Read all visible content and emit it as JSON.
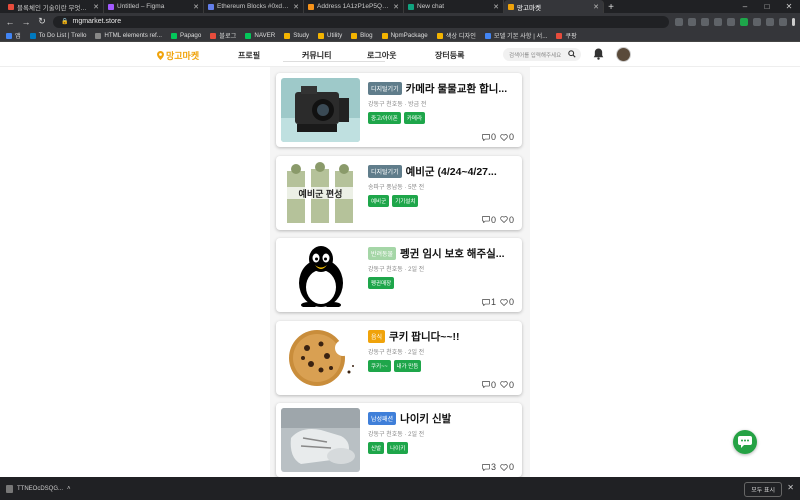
{
  "browser": {
    "tabs": [
      {
        "label": "블록체인 기술이란 무엇일까요?",
        "color": "#e74c3c"
      },
      {
        "label": "Untitled – Figma",
        "color": "#a259ff"
      },
      {
        "label": "Ethereum Blocks #0xdAe0674076",
        "color": "#627eea"
      },
      {
        "label": "Address 1A1zP1eP5QGefi2DMP",
        "color": "#f7931a"
      },
      {
        "label": "New chat",
        "color": "#10a37f"
      },
      {
        "label": "망고마켓",
        "color": "#f0a30a",
        "active": true
      }
    ],
    "url": "mgmarket.store",
    "bookmarks": [
      {
        "label": "앱",
        "color": "#4285f4"
      },
      {
        "label": "To Do List | Trello",
        "color": "#0079bf"
      },
      {
        "label": "HTML elements ref...",
        "color": "#888888"
      },
      {
        "label": "Papago",
        "color": "#03c75a"
      },
      {
        "label": "블로그",
        "color": "#e74c3c"
      },
      {
        "label": "NAVER",
        "color": "#03c75a"
      },
      {
        "label": "Study",
        "color": "#f4b400"
      },
      {
        "label": "Utility",
        "color": "#f4b400"
      },
      {
        "label": "Blog",
        "color": "#f4b400"
      },
      {
        "label": "NpmPackage",
        "color": "#f4b400"
      },
      {
        "label": "색상 디자인",
        "color": "#f4b400"
      },
      {
        "label": "모델 기본 사항 | 서...",
        "color": "#4285f4"
      },
      {
        "label": "쿠팡",
        "color": "#e74c3c"
      }
    ]
  },
  "header": {
    "logo": "망고마켓",
    "nav": [
      "프로필",
      "커뮤니티",
      "로그아웃",
      "장터등록"
    ],
    "search_placeholder": "검색어를 입력해주세요"
  },
  "posts": [
    {
      "category": "디지털기기",
      "category_color": "#607d8b",
      "title": "카메라 물물교환 합니...",
      "meta": "강동구 천호동 · 방금 전",
      "tags": [
        "중고/아이폰",
        "카메라"
      ],
      "comments": "0",
      "likes": "0"
    },
    {
      "category": "디지털기기",
      "category_color": "#607d8b",
      "title": "예비군 (4/24~4/27...",
      "meta": "송파구 풍납동 · 5분 전",
      "tags": [
        "예비군",
        "기기설치"
      ],
      "comments": "0",
      "likes": "0",
      "thumb_text": "예비군 편성"
    },
    {
      "category": "반려동물",
      "category_color": "#a5d6a7",
      "title": "펭귄 임시 보호 해주실...",
      "meta": "강동구 천호동 · 2일 전",
      "tags": [
        "펭귄매장"
      ],
      "comments": "1",
      "likes": "0"
    },
    {
      "category": "음식",
      "category_color": "#f0a30a",
      "title": "쿠키 팝니다~~!!",
      "meta": "강동구 천호동 · 2일 전",
      "tags": [
        "쿠키~~",
        "내가 만듬"
      ],
      "comments": "0",
      "likes": "0"
    },
    {
      "category": "남성패션",
      "category_color": "#3f7fd9",
      "title": "나이키 신발",
      "meta": "강동구 천호동 · 2일 전",
      "tags": [
        "신발",
        "나이키"
      ],
      "comments": "3",
      "likes": "0"
    }
  ],
  "downloads": {
    "file": "TTNEOcDSQG...",
    "show_all": "모두 표시"
  }
}
